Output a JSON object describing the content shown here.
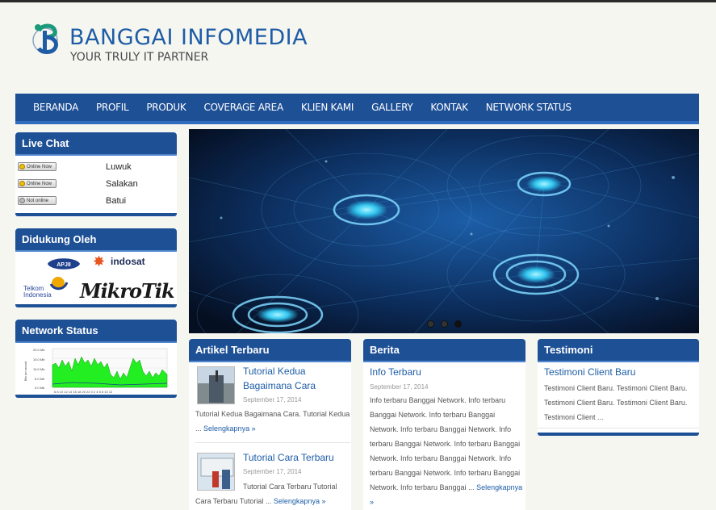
{
  "header": {
    "title": "BANGGAI INFOMEDIA",
    "tagline": "YOUR TRULY IT PARTNER"
  },
  "nav": {
    "items": [
      "BERANDA",
      "PROFIL",
      "PRODUK",
      "COVERAGE AREA",
      "KLIEN KAMI",
      "GALLERY",
      "KONTAK",
      "NETWORK STATUS"
    ]
  },
  "live_chat": {
    "title": "Live Chat",
    "rows": [
      {
        "status": "Online Now",
        "state": "online",
        "city": "Luwuk"
      },
      {
        "status": "Online Now",
        "state": "online",
        "city": "Salakan"
      },
      {
        "status": "Not online",
        "state": "offline",
        "city": "Batui"
      }
    ]
  },
  "sponsors": {
    "title": "Didukung Oleh",
    "apjii": "APJII",
    "indosat": "indosat",
    "telkom_line1": "Telkom",
    "telkom_line2": "Indonesia",
    "mikrotik": "MikroTik"
  },
  "network_status": {
    "title": "Network Status"
  },
  "slider": {
    "dots": 3,
    "active_index": 2
  },
  "articles": {
    "title": "Artikel Terbaru",
    "posts": [
      {
        "title": "Tutorial Kedua Bagaimana Cara",
        "date": "September 17, 2014",
        "body": "Tutorial Kedua Bagaimana Cara. Tutorial Kedua ...",
        "more": "Selengkapnya »"
      },
      {
        "title": "Tutorial Cara Terbaru",
        "date": "September 17, 2014",
        "body": "Tutorial Cara Terbaru Tutorial Cara Terbaru Tutorial ...",
        "more": "Selengkapnya »"
      }
    ]
  },
  "news": {
    "title": "Berita",
    "post": {
      "title": "Info Terbaru",
      "date": "September 17, 2014",
      "body": "Info terbaru Banggai Network. Info terbaru Banggai Network. Info terbaru Banggai Network. Info terbaru Banggai Network. Info terbaru Banggai Network. Info terbaru Banggai Network. Info terbaru Banggai Network. Info terbaru Banggai Network. Info terbaru Banggai Network. Info terbaru Banggai ...",
      "more": "Selengkapnya »"
    }
  },
  "testimoni": {
    "title": "Testimoni",
    "post": {
      "title": "Testimoni Client Baru",
      "body": "Testimoni Client Baru. Testimoni Client Baru. Testimoni Client Baru. Testimoni Client Baru. Testimoni Client ..."
    }
  },
  "colors": {
    "primary": "#1e5096",
    "accent": "#2f6bbf",
    "link": "#1e5da6",
    "graph_fill": "#22ee22"
  }
}
